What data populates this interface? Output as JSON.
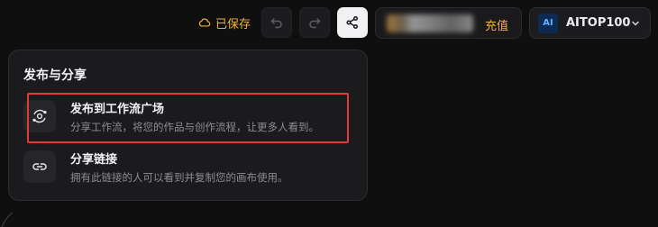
{
  "toolbar": {
    "saved_text": "已保存",
    "recharge_label": "充值",
    "account_name": "AITOP100",
    "avatar_text": "AI"
  },
  "panel": {
    "title": "发布与分享",
    "items": [
      {
        "title": "发布到工作流广场",
        "desc": "分享工作流，将您的作品与创作流程，让更多人看到。"
      },
      {
        "title": "分享链接",
        "desc": "拥有此链接的人可以看到并复制您的画布使用。"
      }
    ]
  },
  "colors": {
    "accent": "#f2b23a",
    "highlight": "#e23b3b",
    "panel_bg": "#1b1b1e",
    "page_bg": "#0f0f10"
  },
  "icons": [
    "cloud-icon",
    "undo-icon",
    "redo-icon",
    "share-icon",
    "chevron-down-icon",
    "publish-orbit-icon",
    "link-icon"
  ]
}
